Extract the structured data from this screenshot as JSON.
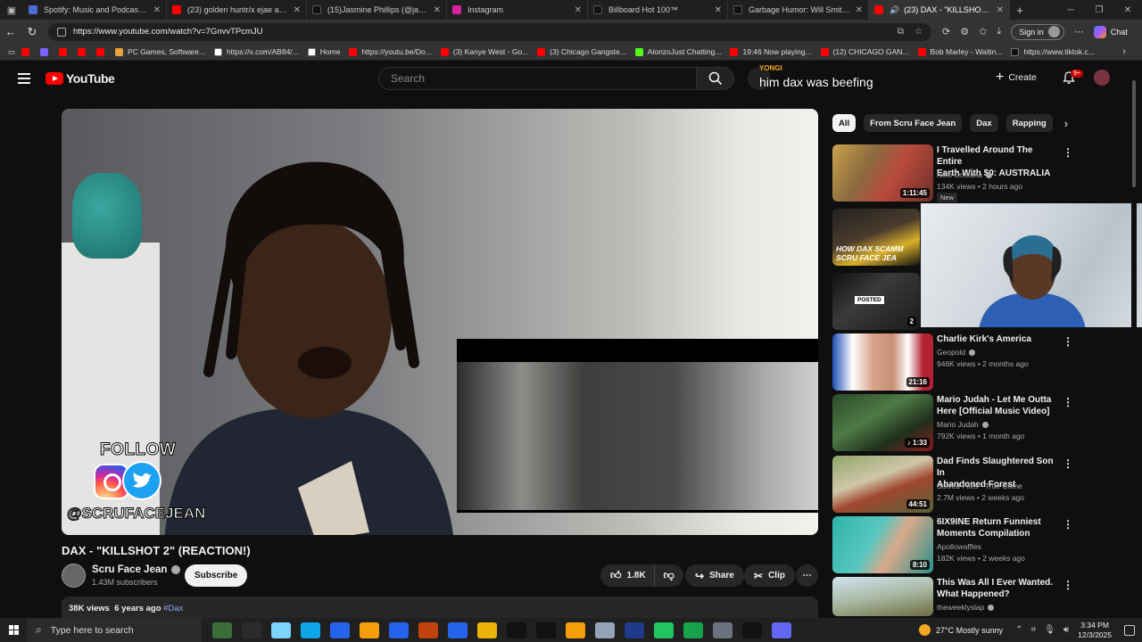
{
  "browser": {
    "tabs": [
      {
        "title": "Spotify: Music and Podcasts App",
        "color": "#4a6cd4",
        "active": false
      },
      {
        "title": "(23) golden huntr/x ejae audrey n",
        "color": "#ff0000",
        "active": false
      },
      {
        "title": "(15)Jasmine Phillips (@jasmine.ph",
        "color": "#111111",
        "active": false
      },
      {
        "title": "Instagram",
        "color": "#d6249f",
        "active": false
      },
      {
        "title": "Billboard Hot 100™",
        "color": "#111111",
        "active": false
      },
      {
        "title": "Garbage Humor: Will Smith and ",
        "color": "#111111",
        "active": false
      },
      {
        "title": "(23) DAX - \"KILLSHOT 2\" (RE",
        "color": "#ff0000",
        "active": true
      }
    ],
    "url": "https://www.youtube.com/watch?v=7GnvvTPcmJU",
    "signin_label": "Sign in",
    "chat_label": "Chat",
    "bookmarks": [
      {
        "label": "",
        "color": "#ff0000"
      },
      {
        "label": "",
        "color": "#7b61ff"
      },
      {
        "label": "",
        "color": "#ff0000"
      },
      {
        "label": "",
        "color": "#ff0000"
      },
      {
        "label": "",
        "color": "#ff0000"
      },
      {
        "label": "PC Games, Software...",
        "color": "#e8a33b"
      },
      {
        "label": "https://x.com/AB84/...",
        "color": "#ffffff"
      },
      {
        "label": "Home",
        "color": "#ffffff"
      },
      {
        "label": "https://youtu.be/Do...",
        "color": "#ff0000"
      },
      {
        "label": "(3) Kanye West - Go...",
        "color": "#ff0000"
      },
      {
        "label": "(3) Chicago Gangste...",
        "color": "#ff0000"
      },
      {
        "label": "AlonzoJust Chatting...",
        "color": "#53fc18"
      },
      {
        "label": "19:46 Now playing...",
        "color": "#ff0000"
      },
      {
        "label": "(12) CHICAGO GAN...",
        "color": "#ff0000"
      },
      {
        "label": "Bob Marley - Waitin...",
        "color": "#ff0000"
      },
      {
        "label": "https://www.tiktok.c...",
        "color": "#111111"
      }
    ]
  },
  "youtube": {
    "logo_text": "YouTube",
    "search_placeholder": "Search",
    "create_label": "Create",
    "notif_badge": "9+",
    "overlay_name": "YONGI",
    "overlay_caption": "him dax was beefing",
    "video": {
      "title": "DAX - \"KILLSHOT 2\" (REACTION!)",
      "follow_text": "FOLLOW",
      "handle_text": "@SCRUFACEJEAN",
      "channel": "Scru Face Jean",
      "subscribers": "1.43M subscribers",
      "subscribe_label": "Subscribe",
      "likes": "1.8K",
      "share_label": "Share",
      "clip_label": "Clip",
      "views": "38K views",
      "age": "6 years ago",
      "hashtag": "#Dax"
    },
    "chips": [
      "All",
      "From Scru Face Jean",
      "Dax",
      "Rapping"
    ],
    "recommendations": [
      {
        "title_l1": "I Travelled Around The Entire",
        "title_l2": "Earth With $0: AUSTRALIA",
        "channel": "Niko Omilana",
        "verified": true,
        "meta": "134K views • 2 hours ago",
        "duration": "1:11:45",
        "badge": "New"
      },
      {
        "title_l1": "",
        "title_l2": "",
        "channel": "",
        "verified": false,
        "meta": "",
        "duration": "",
        "badge": "",
        "thumb_text": "HOW DAX SCAMM SCRU FACE JEA"
      },
      {
        "title_l1": "",
        "title_l2": "",
        "channel": "",
        "verified": false,
        "meta": "",
        "duration": "2",
        "badge": "",
        "thumb_text": "POSTED"
      },
      {
        "title_l1": "Charlie Kirk's America",
        "title_l2": "",
        "channel": "Geopold",
        "verified": true,
        "meta": "946K views • 2 months ago",
        "duration": "21:16",
        "badge": ""
      },
      {
        "title_l1": "Mario Judah - Let Me Outta",
        "title_l2": "Here [Official Music Video]",
        "channel": "Mario Judah",
        "verified": true,
        "meta": "792K views • 1 month ago",
        "duration": "1:33",
        "badge": ""
      },
      {
        "title_l1": "Dad Finds Slaughtered Son In",
        "title_l2": "Abandoned Forest",
        "channel": "Solved Files - True Crime",
        "verified": false,
        "meta": "2.7M views • 2 weeks ago",
        "duration": "44:51",
        "badge": ""
      },
      {
        "title_l1": "6IX9INE Return Funniest",
        "title_l2": "Moments Compilation",
        "channel": "Apollowaffles",
        "verified": false,
        "meta": "182K views • 2 weeks ago",
        "duration": "8:10",
        "badge": ""
      },
      {
        "title_l1": "This Was All I Ever Wanted.",
        "title_l2": "What Happened?",
        "channel": "theweeklyslap",
        "verified": true,
        "meta": "",
        "duration": "",
        "badge": ""
      }
    ]
  },
  "taskbar": {
    "search_placeholder": "Type here to search",
    "weather": "27°C  Mostly sunny",
    "time": "3:34 PM",
    "date": "12/3/2025",
    "apps": [
      "#3a6f3a",
      "#2b2b2b",
      "#7dd3fc",
      "#0ea5e9",
      "#2563eb",
      "#f59e0b",
      "#2563eb",
      "#c2410c",
      "#2563eb",
      "#eab308",
      "#111111",
      "#111111",
      "#f59e0b",
      "#94a3b8",
      "#1e3a8a",
      "#22c55e",
      "#16a34a",
      "#6b7280",
      "#111111",
      "#6366f1"
    ]
  }
}
